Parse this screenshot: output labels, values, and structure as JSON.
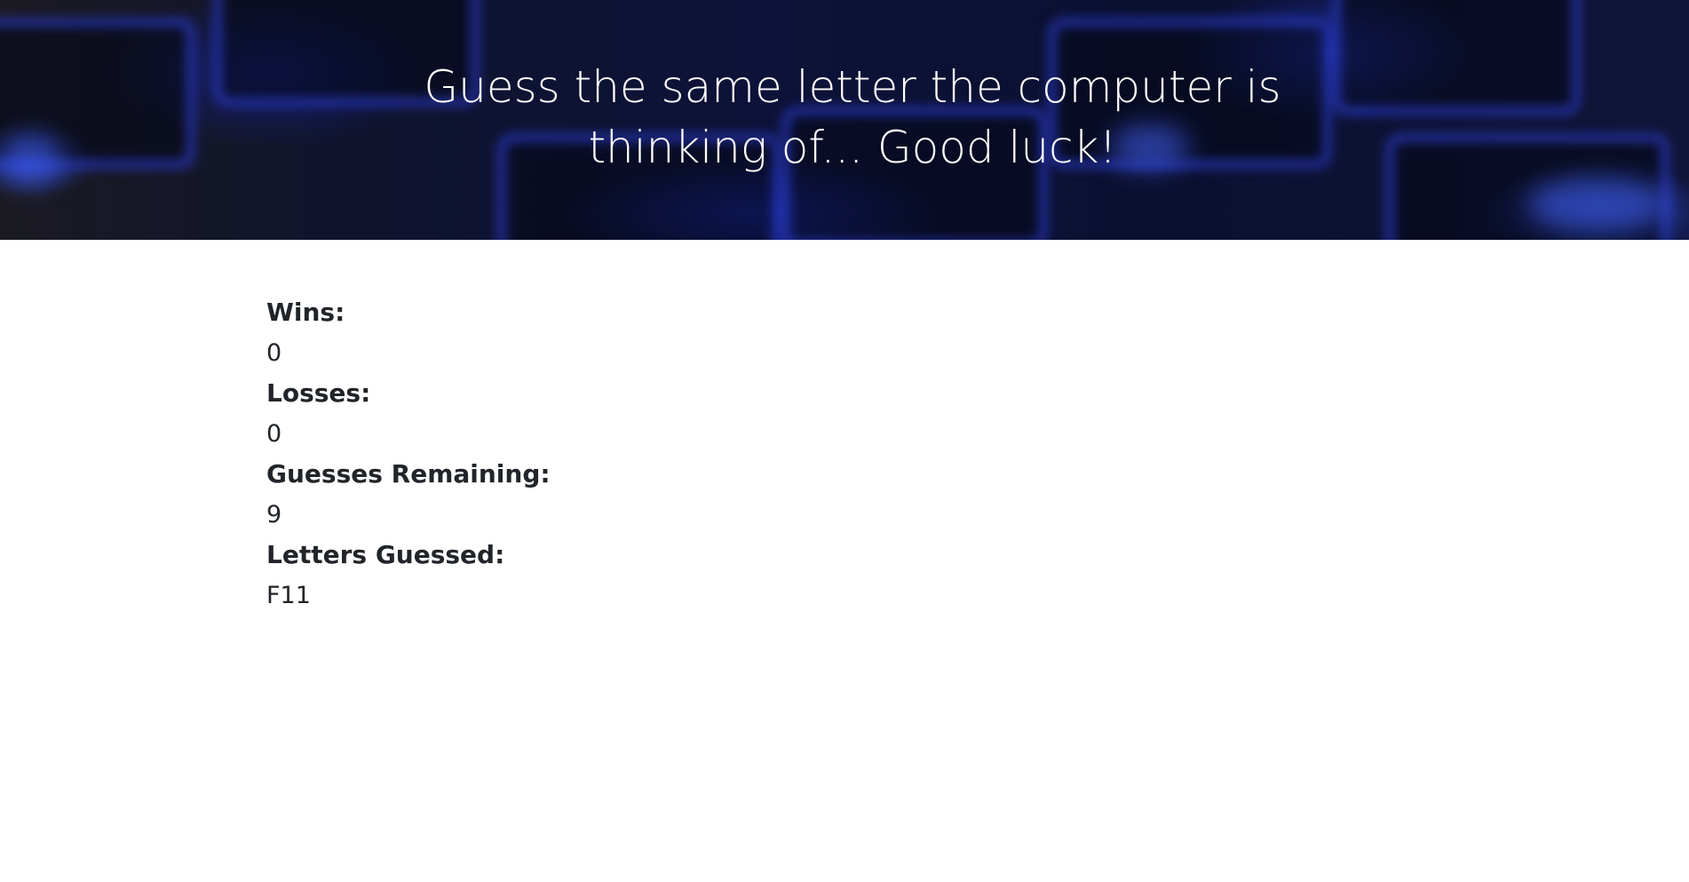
{
  "header": {
    "title": "Guess the same letter the computer is thinking of... Good luck!"
  },
  "stats": {
    "wins_label": "Wins:",
    "wins_value": "0",
    "losses_label": "Losses:",
    "losses_value": "0",
    "guesses_label": "Guesses Remaining:",
    "guesses_value": "9",
    "letters_label": "Letters Guessed:",
    "letters_value": "F11"
  },
  "colors": {
    "accent_blue": "#2a3cff",
    "text": "#212529",
    "hero_text": "#ffffff"
  }
}
